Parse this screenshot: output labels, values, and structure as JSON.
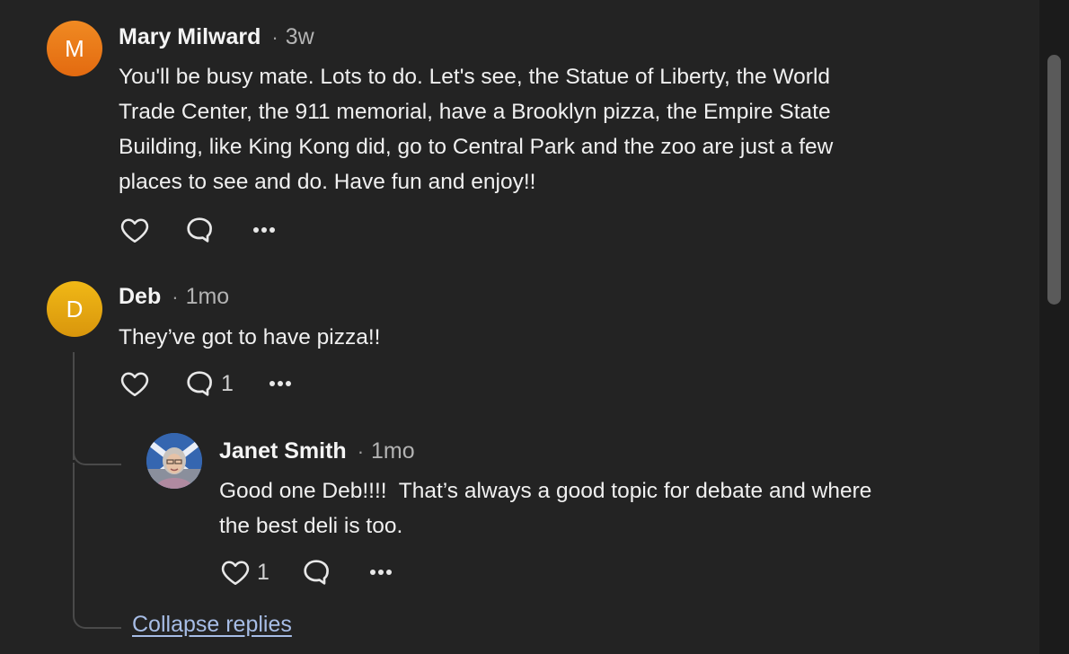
{
  "colors": {
    "background": "#232323",
    "text": "#f0f0f0",
    "muted": "#b3b3b3",
    "link": "#a7bde6",
    "avatar_mary": "#e9791a",
    "avatar_deb": "#e0a50e"
  },
  "comments": [
    {
      "avatar_letter": "M",
      "author": "Mary Milward",
      "separator": "·",
      "time": "3w",
      "lines": [
        "You'll be busy mate. Lots to do. Let's see, the Statue of Liberty, the World",
        "Trade Center, the 911 memorial, have a Brooklyn pizza, the Empire State",
        "Building, like King Kong did, go to Central Park and the zoo are just a few",
        "places to see and do. Have fun and enjoy!!"
      ],
      "like_count": "",
      "reply_count": ""
    },
    {
      "avatar_letter": "D",
      "author": "Deb",
      "separator": "·",
      "time": "1mo",
      "lines": [
        "They’ve got to have pizza!!"
      ],
      "like_count": "",
      "reply_count": "1"
    },
    {
      "avatar_letter": "",
      "author": "Janet Smith",
      "separator": "·",
      "time": "1mo",
      "lines": [
        "Good one Deb!!!!  That’s always a good topic for debate and where",
        "the best deli is too."
      ],
      "like_count": "1",
      "reply_count": ""
    }
  ],
  "collapse_label": "Collapse replies",
  "icons": {
    "like": "heart-icon",
    "reply": "speech-bubble-icon",
    "more": "more-dots-icon"
  }
}
